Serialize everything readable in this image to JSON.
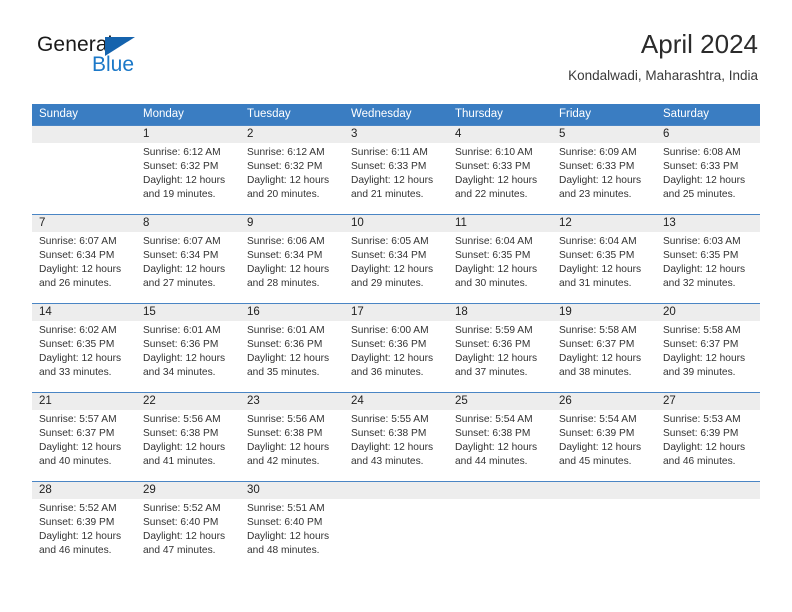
{
  "brand": {
    "name_part1": "General",
    "name_part2": "Blue",
    "accent_color": "#1b78c8",
    "triangle_color": "#1563ad"
  },
  "header": {
    "title": "April 2024",
    "subtitle": "Kondalwadi, Maharashtra, India"
  },
  "theme": {
    "header_row_bg": "#3a7dc2",
    "date_band_bg": "#ededed",
    "row_divider": "#4a85c4",
    "text": "#333333"
  },
  "weekdays": [
    "Sunday",
    "Monday",
    "Tuesday",
    "Wednesday",
    "Thursday",
    "Friday",
    "Saturday"
  ],
  "weeks": [
    {
      "numbers": [
        "",
        "1",
        "2",
        "3",
        "4",
        "5",
        "6"
      ],
      "cells": [
        {
          "sunrise": "",
          "sunset": "",
          "daylight_line1": "",
          "daylight_line2": ""
        },
        {
          "sunrise": "Sunrise: 6:12 AM",
          "sunset": "Sunset: 6:32 PM",
          "daylight_line1": "Daylight: 12 hours",
          "daylight_line2": "and 19 minutes."
        },
        {
          "sunrise": "Sunrise: 6:12 AM",
          "sunset": "Sunset: 6:32 PM",
          "daylight_line1": "Daylight: 12 hours",
          "daylight_line2": "and 20 minutes."
        },
        {
          "sunrise": "Sunrise: 6:11 AM",
          "sunset": "Sunset: 6:33 PM",
          "daylight_line1": "Daylight: 12 hours",
          "daylight_line2": "and 21 minutes."
        },
        {
          "sunrise": "Sunrise: 6:10 AM",
          "sunset": "Sunset: 6:33 PM",
          "daylight_line1": "Daylight: 12 hours",
          "daylight_line2": "and 22 minutes."
        },
        {
          "sunrise": "Sunrise: 6:09 AM",
          "sunset": "Sunset: 6:33 PM",
          "daylight_line1": "Daylight: 12 hours",
          "daylight_line2": "and 23 minutes."
        },
        {
          "sunrise": "Sunrise: 6:08 AM",
          "sunset": "Sunset: 6:33 PM",
          "daylight_line1": "Daylight: 12 hours",
          "daylight_line2": "and 25 minutes."
        }
      ]
    },
    {
      "numbers": [
        "7",
        "8",
        "9",
        "10",
        "11",
        "12",
        "13"
      ],
      "cells": [
        {
          "sunrise": "Sunrise: 6:07 AM",
          "sunset": "Sunset: 6:34 PM",
          "daylight_line1": "Daylight: 12 hours",
          "daylight_line2": "and 26 minutes."
        },
        {
          "sunrise": "Sunrise: 6:07 AM",
          "sunset": "Sunset: 6:34 PM",
          "daylight_line1": "Daylight: 12 hours",
          "daylight_line2": "and 27 minutes."
        },
        {
          "sunrise": "Sunrise: 6:06 AM",
          "sunset": "Sunset: 6:34 PM",
          "daylight_line1": "Daylight: 12 hours",
          "daylight_line2": "and 28 minutes."
        },
        {
          "sunrise": "Sunrise: 6:05 AM",
          "sunset": "Sunset: 6:34 PM",
          "daylight_line1": "Daylight: 12 hours",
          "daylight_line2": "and 29 minutes."
        },
        {
          "sunrise": "Sunrise: 6:04 AM",
          "sunset": "Sunset: 6:35 PM",
          "daylight_line1": "Daylight: 12 hours",
          "daylight_line2": "and 30 minutes."
        },
        {
          "sunrise": "Sunrise: 6:04 AM",
          "sunset": "Sunset: 6:35 PM",
          "daylight_line1": "Daylight: 12 hours",
          "daylight_line2": "and 31 minutes."
        },
        {
          "sunrise": "Sunrise: 6:03 AM",
          "sunset": "Sunset: 6:35 PM",
          "daylight_line1": "Daylight: 12 hours",
          "daylight_line2": "and 32 minutes."
        }
      ]
    },
    {
      "numbers": [
        "14",
        "15",
        "16",
        "17",
        "18",
        "19",
        "20"
      ],
      "cells": [
        {
          "sunrise": "Sunrise: 6:02 AM",
          "sunset": "Sunset: 6:35 PM",
          "daylight_line1": "Daylight: 12 hours",
          "daylight_line2": "and 33 minutes."
        },
        {
          "sunrise": "Sunrise: 6:01 AM",
          "sunset": "Sunset: 6:36 PM",
          "daylight_line1": "Daylight: 12 hours",
          "daylight_line2": "and 34 minutes."
        },
        {
          "sunrise": "Sunrise: 6:01 AM",
          "sunset": "Sunset: 6:36 PM",
          "daylight_line1": "Daylight: 12 hours",
          "daylight_line2": "and 35 minutes."
        },
        {
          "sunrise": "Sunrise: 6:00 AM",
          "sunset": "Sunset: 6:36 PM",
          "daylight_line1": "Daylight: 12 hours",
          "daylight_line2": "and 36 minutes."
        },
        {
          "sunrise": "Sunrise: 5:59 AM",
          "sunset": "Sunset: 6:36 PM",
          "daylight_line1": "Daylight: 12 hours",
          "daylight_line2": "and 37 minutes."
        },
        {
          "sunrise": "Sunrise: 5:58 AM",
          "sunset": "Sunset: 6:37 PM",
          "daylight_line1": "Daylight: 12 hours",
          "daylight_line2": "and 38 minutes."
        },
        {
          "sunrise": "Sunrise: 5:58 AM",
          "sunset": "Sunset: 6:37 PM",
          "daylight_line1": "Daylight: 12 hours",
          "daylight_line2": "and 39 minutes."
        }
      ]
    },
    {
      "numbers": [
        "21",
        "22",
        "23",
        "24",
        "25",
        "26",
        "27"
      ],
      "cells": [
        {
          "sunrise": "Sunrise: 5:57 AM",
          "sunset": "Sunset: 6:37 PM",
          "daylight_line1": "Daylight: 12 hours",
          "daylight_line2": "and 40 minutes."
        },
        {
          "sunrise": "Sunrise: 5:56 AM",
          "sunset": "Sunset: 6:38 PM",
          "daylight_line1": "Daylight: 12 hours",
          "daylight_line2": "and 41 minutes."
        },
        {
          "sunrise": "Sunrise: 5:56 AM",
          "sunset": "Sunset: 6:38 PM",
          "daylight_line1": "Daylight: 12 hours",
          "daylight_line2": "and 42 minutes."
        },
        {
          "sunrise": "Sunrise: 5:55 AM",
          "sunset": "Sunset: 6:38 PM",
          "daylight_line1": "Daylight: 12 hours",
          "daylight_line2": "and 43 minutes."
        },
        {
          "sunrise": "Sunrise: 5:54 AM",
          "sunset": "Sunset: 6:38 PM",
          "daylight_line1": "Daylight: 12 hours",
          "daylight_line2": "and 44 minutes."
        },
        {
          "sunrise": "Sunrise: 5:54 AM",
          "sunset": "Sunset: 6:39 PM",
          "daylight_line1": "Daylight: 12 hours",
          "daylight_line2": "and 45 minutes."
        },
        {
          "sunrise": "Sunrise: 5:53 AM",
          "sunset": "Sunset: 6:39 PM",
          "daylight_line1": "Daylight: 12 hours",
          "daylight_line2": "and 46 minutes."
        }
      ]
    },
    {
      "numbers": [
        "28",
        "29",
        "30",
        "",
        "",
        "",
        ""
      ],
      "cells": [
        {
          "sunrise": "Sunrise: 5:52 AM",
          "sunset": "Sunset: 6:39 PM",
          "daylight_line1": "Daylight: 12 hours",
          "daylight_line2": "and 46 minutes."
        },
        {
          "sunrise": "Sunrise: 5:52 AM",
          "sunset": "Sunset: 6:40 PM",
          "daylight_line1": "Daylight: 12 hours",
          "daylight_line2": "and 47 minutes."
        },
        {
          "sunrise": "Sunrise: 5:51 AM",
          "sunset": "Sunset: 6:40 PM",
          "daylight_line1": "Daylight: 12 hours",
          "daylight_line2": "and 48 minutes."
        },
        {
          "sunrise": "",
          "sunset": "",
          "daylight_line1": "",
          "daylight_line2": ""
        },
        {
          "sunrise": "",
          "sunset": "",
          "daylight_line1": "",
          "daylight_line2": ""
        },
        {
          "sunrise": "",
          "sunset": "",
          "daylight_line1": "",
          "daylight_line2": ""
        },
        {
          "sunrise": "",
          "sunset": "",
          "daylight_line1": "",
          "daylight_line2": ""
        }
      ]
    }
  ]
}
